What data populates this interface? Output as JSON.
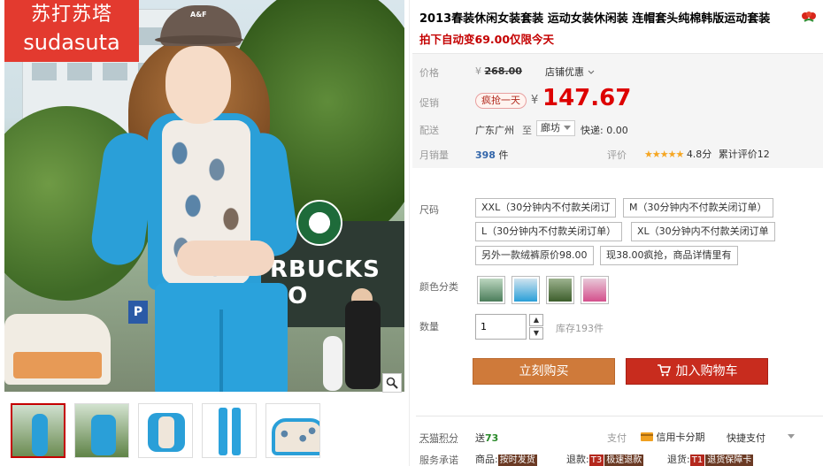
{
  "brand": {
    "name_cn": "苏打苏塔",
    "name_en": "sudasuta"
  },
  "photo": {
    "cap_text": "A&F",
    "storefront_text": "RBUCKS CO",
    "parking_sign": "P"
  },
  "product": {
    "title": "2013春装休闲女装套装 运动女装休闲装 连帽套头纯棉韩版运动套装",
    "promo_text": "拍下自动变69.00仅限今天"
  },
  "price": {
    "label": "价格",
    "currency": "¥",
    "original": "268.00",
    "store_discount": "店铺优惠",
    "promo_label": "促销",
    "flash_badge": "疯抢一天",
    "promo_price": "147.67"
  },
  "shipping": {
    "label": "配送",
    "from": "广东广州",
    "to_word": "至",
    "destination": "廊坊",
    "fee": "快递: 0.00"
  },
  "sales": {
    "label": "月销量",
    "count": "398",
    "unit": "件",
    "rating_label": "评价",
    "stars": "★★★★★",
    "score": "4.8分",
    "review_count": "累计评价12"
  },
  "sizes": {
    "label": "尺码",
    "options": [
      "XXL（30分钟内不付款关闭订",
      "M（30分钟内不付款关闭订单）",
      "L（30分钟内不付款关闭订单）",
      "XL（30分钟内不付款关闭订单",
      "另外一款绒裤原价98.00",
      "现38.00疯抢，商品详情里有"
    ]
  },
  "colors": {
    "label": "颜色分类"
  },
  "quantity": {
    "label": "数量",
    "value": "1",
    "stock": "库存193件",
    "up": "▲",
    "down": "▼"
  },
  "actions": {
    "buy_now": "立刻购买",
    "add_cart": "加入购物车"
  },
  "footer": {
    "points_label": "天猫积分",
    "points_prefix": "送",
    "points_value": "73",
    "pay_label": "支付",
    "credit_installment": "信用卡分期",
    "quick_pay": "快捷支付",
    "service_label": "服务承诺",
    "goods_label": "商品:",
    "goods_tag": "按时发货",
    "return_label": "退款:",
    "return_code": "T3",
    "return_tag": "极速退款",
    "refund_label": "退货:",
    "refund_code": "T1",
    "refund_tag": "退货保障卡"
  },
  "accent_colors": {
    "price_red": "#dd0000",
    "buy_orange": "#cf7a3a",
    "cart_red": "#c82c1e",
    "brand_red": "#e33a2f"
  }
}
